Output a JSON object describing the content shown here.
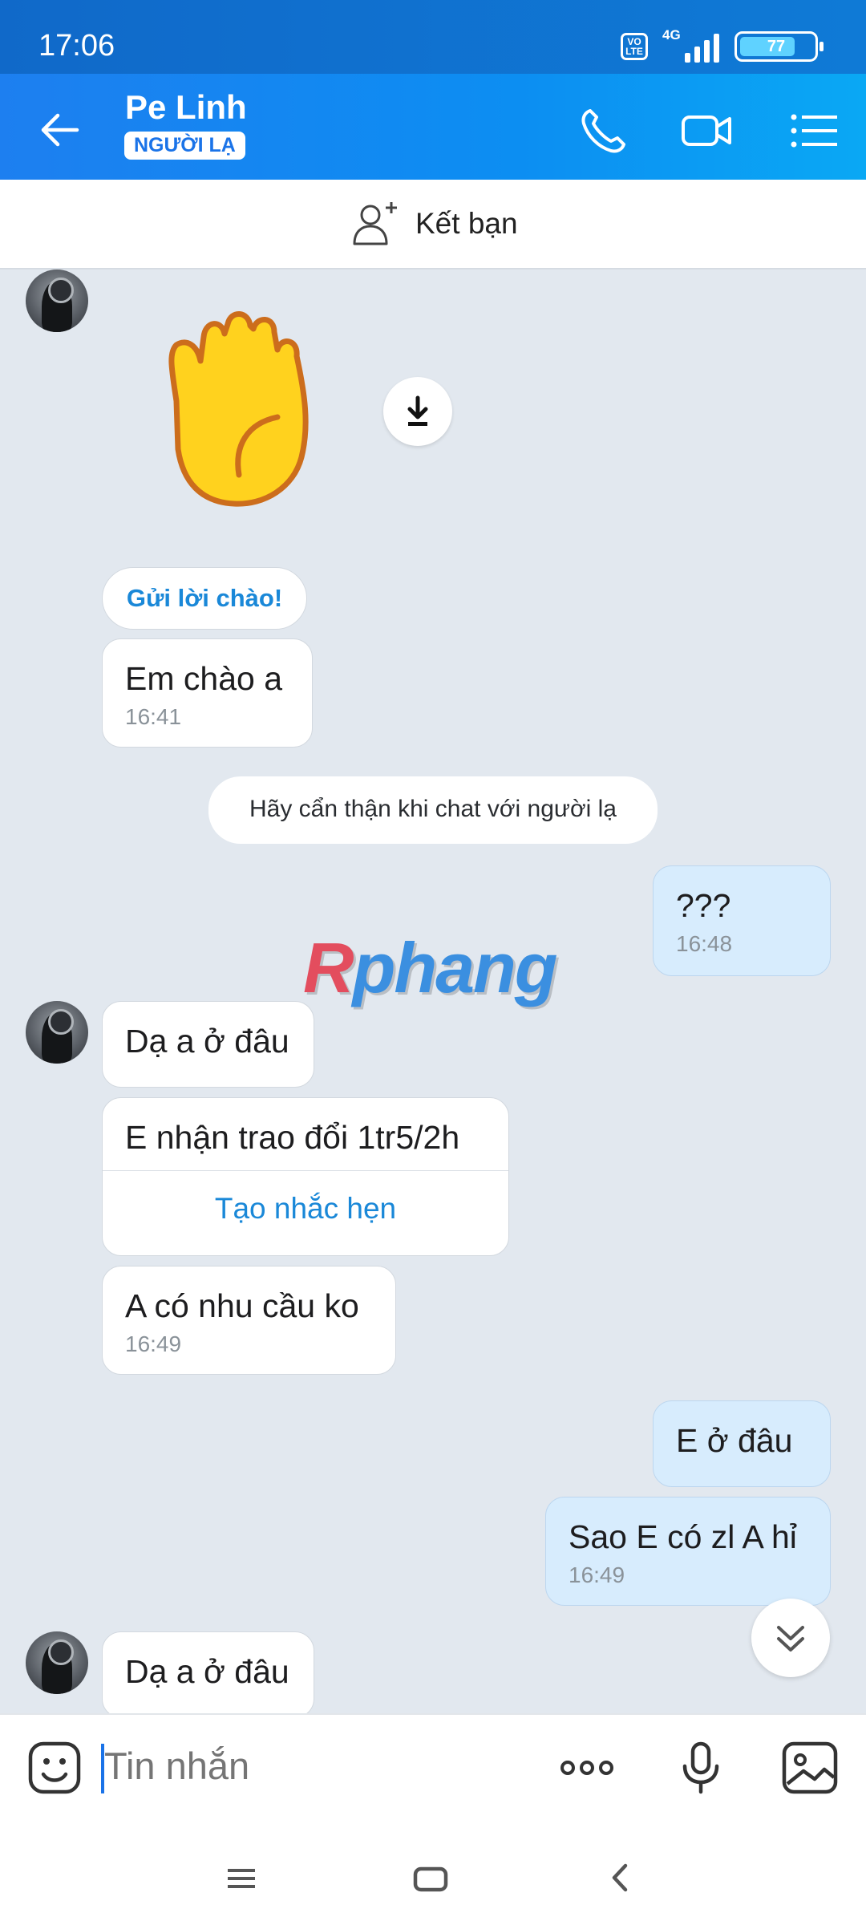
{
  "status": {
    "time": "17:06",
    "volte": "VO LTE",
    "network": "4G",
    "battery": "77",
    "battery_level": 0.77
  },
  "header": {
    "title": "Pe Linh",
    "badge": "NGƯỜI LẠ"
  },
  "friend_bar": {
    "label": "Kết bạn"
  },
  "sticker": {
    "name": "raised-hand-emoji"
  },
  "messages": {
    "greet_pill": "Gửi lời chào!",
    "m1": {
      "text": "Em chào a",
      "time": "16:41"
    },
    "caution": "Hãy cẩn thận khi chat với người lạ",
    "m2": {
      "text": "???",
      "time": "16:48"
    },
    "m3": {
      "text": "Dạ a ở đâu"
    },
    "m4": {
      "text": "E nhận trao đổi 1tr5/2h",
      "action": "Tạo nhắc hẹn"
    },
    "m5": {
      "text": "A có nhu cầu ko",
      "time": "16:49"
    },
    "m6": {
      "text": "E ở đâu"
    },
    "m7": {
      "text": "Sao E có zl A hỉ",
      "time": "16:49"
    },
    "m8": {
      "text": "Dạ a ở đâu"
    }
  },
  "watermark": {
    "first": "R",
    "rest": "phang"
  },
  "input": {
    "placeholder": "Tin nhắn"
  },
  "colors": {
    "header_start": "#1d7ff0",
    "header_end": "#0aa8f4",
    "accent": "#1a73e8",
    "chat_bg": "#e2e8ef",
    "outgoing_bubble": "#d7ecfd"
  }
}
